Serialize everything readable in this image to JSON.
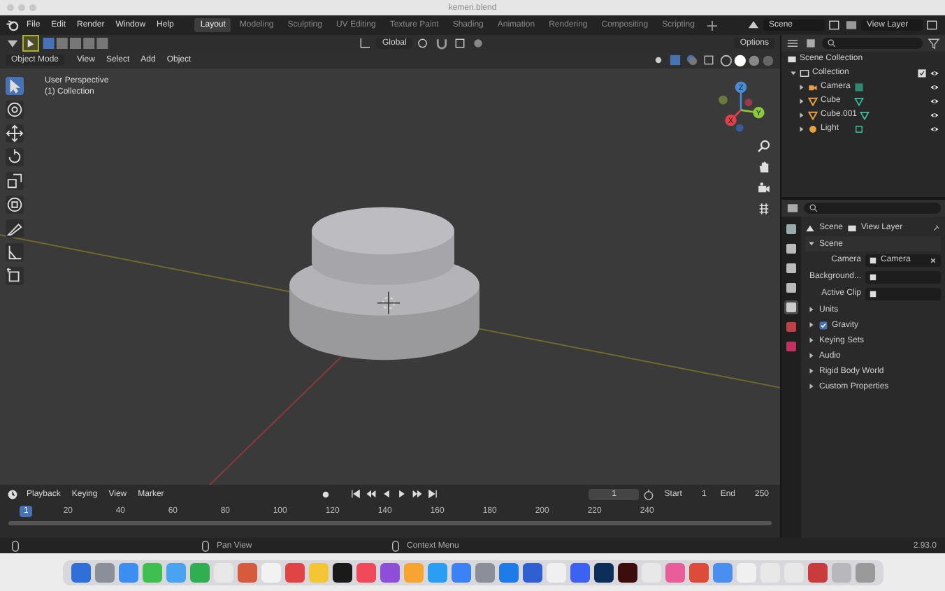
{
  "window": {
    "title": "kemeri.blend"
  },
  "menu": [
    "File",
    "Edit",
    "Render",
    "Window",
    "Help"
  ],
  "workspaces": [
    {
      "label": "Layout",
      "selected": true
    },
    {
      "label": "Modeling",
      "selected": false
    },
    {
      "label": "Sculpting",
      "selected": false
    },
    {
      "label": "UV Editing",
      "selected": false
    },
    {
      "label": "Texture Paint",
      "selected": false
    },
    {
      "label": "Shading",
      "selected": false
    },
    {
      "label": "Animation",
      "selected": false
    },
    {
      "label": "Rendering",
      "selected": false
    },
    {
      "label": "Compositing",
      "selected": false
    },
    {
      "label": "Scripting",
      "selected": false
    }
  ],
  "scene": "Scene",
  "view_layer": "View Layer",
  "header": {
    "orientation": "Global",
    "options": "Options",
    "mode": "Object Mode",
    "menus": [
      "View",
      "Select",
      "Add",
      "Object"
    ]
  },
  "viewport": {
    "perspective": "User Perspective",
    "collection": "(1) Collection",
    "axes": [
      "X",
      "Y",
      "Z"
    ]
  },
  "tools": [
    {
      "kind": "select",
      "selected": true
    },
    {
      "kind": "cursor",
      "selected": false
    },
    {
      "kind": "move",
      "selected": false
    },
    {
      "kind": "rotate",
      "selected": false
    },
    {
      "kind": "scale",
      "selected": false
    },
    {
      "kind": "transform",
      "selected": false
    },
    {
      "kind": "annotate",
      "selected": false
    },
    {
      "kind": "measure",
      "selected": false
    },
    {
      "kind": "add",
      "selected": false
    }
  ],
  "outliner": {
    "root": "Scene Collection",
    "collection": {
      "label": "Collection",
      "expanded": true,
      "children": [
        {
          "label": "Camera",
          "kind": "camera",
          "expanded": false
        },
        {
          "label": "Cube",
          "kind": "mesh",
          "expanded": false
        },
        {
          "label": "Cube.001",
          "kind": "mesh",
          "expanded": false
        },
        {
          "label": "Light",
          "kind": "light",
          "expanded": false
        }
      ]
    }
  },
  "properties": {
    "tabs": [
      {
        "kind": "tool",
        "selected": false
      },
      {
        "kind": "render",
        "selected": false
      },
      {
        "kind": "output",
        "selected": false
      },
      {
        "kind": "view",
        "selected": false
      },
      {
        "kind": "scene",
        "selected": true
      },
      {
        "kind": "world",
        "selected": false
      },
      {
        "kind": "texture",
        "selected": false
      }
    ],
    "breadcrumbs": [
      "Scene",
      "View Layer"
    ],
    "section": {
      "label": "Scene",
      "expanded": true
    },
    "fields": [
      {
        "label": "Camera",
        "value": "Camera"
      },
      {
        "label": "Background..."
      },
      {
        "label": "Active Clip"
      }
    ],
    "panels": [
      {
        "label": "Units",
        "kind": "panel"
      },
      {
        "label": "Gravity",
        "kind": "check",
        "checked": true
      },
      {
        "label": "Keying Sets",
        "kind": "panel"
      },
      {
        "label": "Audio",
        "kind": "panel"
      },
      {
        "label": "Rigid Body World",
        "kind": "panel"
      },
      {
        "label": "Custom Properties",
        "kind": "panel"
      }
    ]
  },
  "timeline": {
    "menus": [
      "Playback",
      "Keying",
      "View",
      "Marker"
    ],
    "frame": "1",
    "start_label": "Start",
    "start": "1",
    "end_label": "End",
    "end": "250",
    "current": "1",
    "ticks": [
      "20",
      "40",
      "60",
      "80",
      "100",
      "120",
      "140",
      "160",
      "180",
      "200",
      "220",
      "240"
    ]
  },
  "status_bar": {
    "hints": [
      "Pan View",
      "Context Menu"
    ],
    "version": "2.93.0"
  },
  "dock": [
    {
      "color": "#2f6fd8"
    },
    {
      "color": "#8a8f99"
    },
    {
      "color": "#3b8ff0"
    },
    {
      "color": "#3fbf4f"
    },
    {
      "color": "#4aa3f0"
    },
    {
      "color": "#2fae52"
    },
    {
      "color": "#e8e8e8"
    },
    {
      "color": "#d65a3c"
    },
    {
      "color": "#f2f2f2"
    },
    {
      "color": "#e04444"
    },
    {
      "color": "#f4c534"
    },
    {
      "color": "#1a1a1a"
    },
    {
      "color": "#f04a5a"
    },
    {
      "color": "#8e4ed8"
    },
    {
      "color": "#f7a531"
    },
    {
      "color": "#2a9df4"
    },
    {
      "color": "#3b82f6"
    },
    {
      "color": "#8a8f99"
    },
    {
      "color": "#1e7ce8"
    },
    {
      "color": "#2f5fd0"
    },
    {
      "color": "#f0f0f0"
    },
    {
      "color": "#3b62f0"
    },
    {
      "color": "#0c2f5a"
    },
    {
      "color": "#3d0c0c"
    },
    {
      "color": "#e8e8e8"
    },
    {
      "color": "#e85d9a"
    },
    {
      "color": "#dd4b39"
    },
    {
      "color": "#4a8ef0"
    },
    {
      "color": "#f0f0f0"
    },
    {
      "color": "#e8e8e8"
    },
    {
      "color": "#e8e8e8"
    },
    {
      "color": "#c83c3c"
    },
    {
      "color": "#b8b8bc"
    },
    {
      "color": "#9a9a9a"
    }
  ]
}
